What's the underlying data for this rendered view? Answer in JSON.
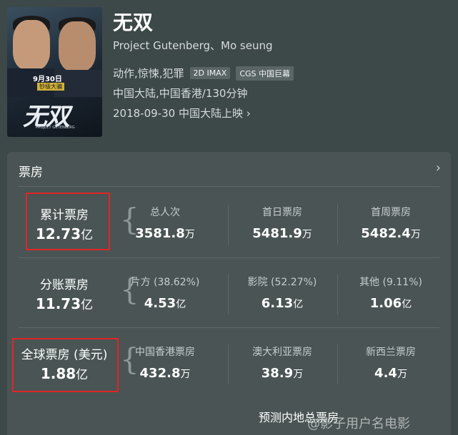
{
  "movie": {
    "poster_date": "9月30日",
    "poster_tag": "钞级大骗",
    "poster_title": "无双",
    "poster_sub": "PROJECT GUTENBERG",
    "title": "无双",
    "original_title": "Project Gutenberg、Mo seung",
    "genre": "动作,惊悚,犯罪",
    "badges": [
      "2D IMAX",
      "CGS 中国巨幕"
    ],
    "region_runtime": "中国大陆,中国香港/130分钟",
    "release": "2018-09-30 中国大陆上映",
    "release_chevron": "›"
  },
  "box_office": {
    "title": "票房",
    "chevron": "›",
    "rows": [
      {
        "main_label": "累计票房",
        "main_value": "12.73",
        "main_unit": "亿",
        "cells": [
          {
            "label": "总人次",
            "value": "3581.8",
            "unit": "万"
          },
          {
            "label": "首日票房",
            "value": "5481.9",
            "unit": "万"
          },
          {
            "label": "首周票房",
            "value": "5482.4",
            "unit": "万"
          }
        ]
      },
      {
        "main_label": "分账票房",
        "main_value": "11.73",
        "main_unit": "亿",
        "cells": [
          {
            "label": "片方 (38.62%)",
            "value": "4.53",
            "unit": "亿"
          },
          {
            "label": "影院 (52.27%)",
            "value": "6.13",
            "unit": "亿"
          },
          {
            "label": "其他 (9.11%)",
            "value": "1.06",
            "unit": "亿"
          }
        ]
      },
      {
        "main_label": "全球票房 (美元)",
        "main_value": "1.88",
        "main_unit": "亿",
        "cells": [
          {
            "label": "中国香港票房",
            "value": "432.8",
            "unit": "万"
          },
          {
            "label": "澳大利亚票房",
            "value": "38.9",
            "unit": "万"
          },
          {
            "label": "新西兰票房",
            "value": "4.4",
            "unit": "万"
          }
        ]
      }
    ],
    "footer": "预测内地总票房",
    "highlight_color": "#e02525"
  },
  "watermark": "@影子用户名电影"
}
